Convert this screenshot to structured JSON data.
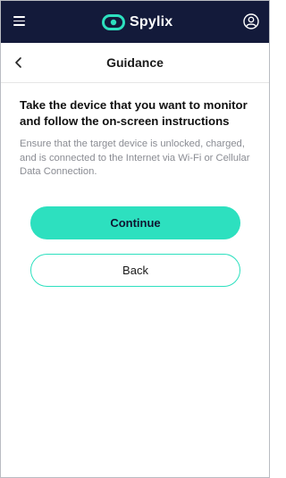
{
  "header": {
    "brand": "Spylix",
    "icons": {
      "menu": "hamburger-menu-icon",
      "logo": "spylix-logo-icon",
      "account": "user-account-icon"
    },
    "colors": {
      "bar": "#131a3a",
      "accent": "#2de0bf"
    }
  },
  "nav": {
    "title": "Guidance",
    "back_icon": "chevron-left-icon"
  },
  "content": {
    "heading": "Take the device that you want to monitor and follow the on-screen instructions",
    "description": "Ensure that the target device is unlocked, charged, and is connected to the Internet via Wi-Fi or Cellular Data Connection."
  },
  "actions": {
    "continue_label": "Continue",
    "back_label": "Back"
  }
}
